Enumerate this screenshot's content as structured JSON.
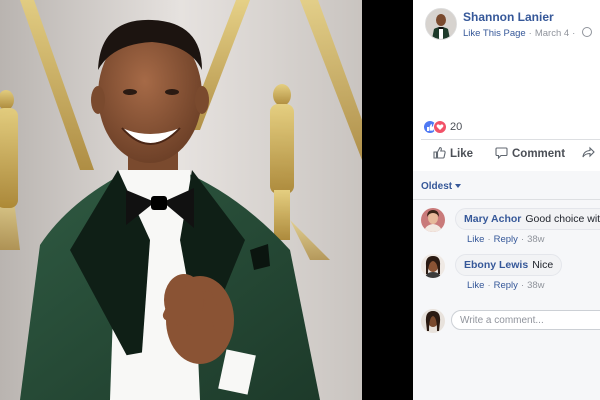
{
  "post": {
    "author": "Shannon Lanier",
    "like_page": "Like This Page",
    "sep": "·",
    "date": "March 4",
    "globe_icon": "globe-icon"
  },
  "reactions": {
    "count": "20",
    "icons": [
      "like-reaction-icon",
      "love-reaction-icon"
    ]
  },
  "actions": {
    "like": "Like",
    "comment": "Comment"
  },
  "comments": {
    "sort": "Oldest",
    "items": [
      {
        "author": "Mary Achor",
        "text": "Good choice with th",
        "like": "Like",
        "reply": "Reply",
        "time": "38w"
      },
      {
        "author": "Ebony Lewis",
        "text": "Nice",
        "like": "Like",
        "reply": "Reply",
        "time": "38w"
      }
    ],
    "write_placeholder": "Write a comment...",
    "dot": "·"
  },
  "colors": {
    "link": "#365899",
    "meta": "#90949c",
    "like_blue": "#4f79f3",
    "love_red": "#f25268"
  }
}
